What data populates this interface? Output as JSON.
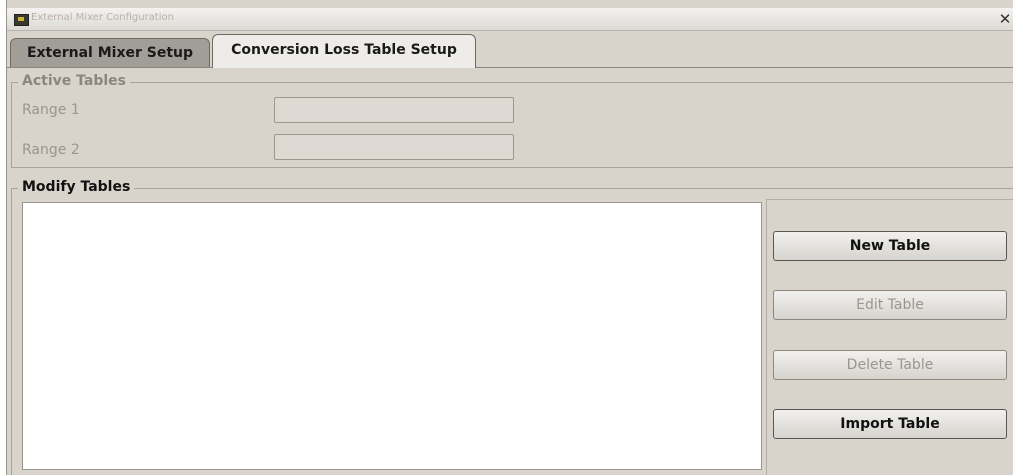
{
  "window": {
    "title": "External Mixer Configuration",
    "close_glyph": "✕",
    "icon": "app-icon"
  },
  "tabs": [
    {
      "label": "External Mixer Setup",
      "active": false
    },
    {
      "label": "Conversion Loss Table Setup",
      "active": true
    }
  ],
  "active_tables": {
    "title": "Active Tables",
    "ranges": [
      {
        "label": "Range 1",
        "value": ""
      },
      {
        "label": "Range 2",
        "value": ""
      }
    ]
  },
  "modify_tables": {
    "title": "Modify Tables",
    "buttons": {
      "new": {
        "label": "New Table",
        "enabled": true
      },
      "edit": {
        "label": "Edit Table",
        "enabled": false
      },
      "delete": {
        "label": "Delete Table",
        "enabled": false
      },
      "import": {
        "label": "Import Table",
        "enabled": true
      }
    }
  }
}
